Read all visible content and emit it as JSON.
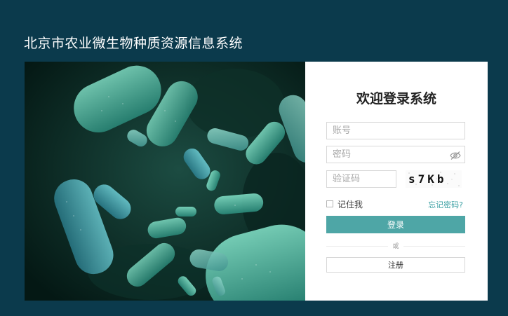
{
  "header": {
    "title": "北京市农业微生物种质资源信息系统"
  },
  "login": {
    "heading": "欢迎登录系统",
    "username_placeholder": "账号",
    "password_placeholder": "密码",
    "captcha_placeholder": "验证码",
    "captcha_text": "s7Kb",
    "remember_label": "记住我",
    "forgot_label": "忘记密码?",
    "login_button": "登录",
    "divider_text": "或",
    "register_button": "注册"
  },
  "colors": {
    "background": "#0b3a4c",
    "accent": "#4ea6a6",
    "link": "#3aa0a3"
  },
  "icons": {
    "password_toggle": "eye-slash-icon"
  }
}
